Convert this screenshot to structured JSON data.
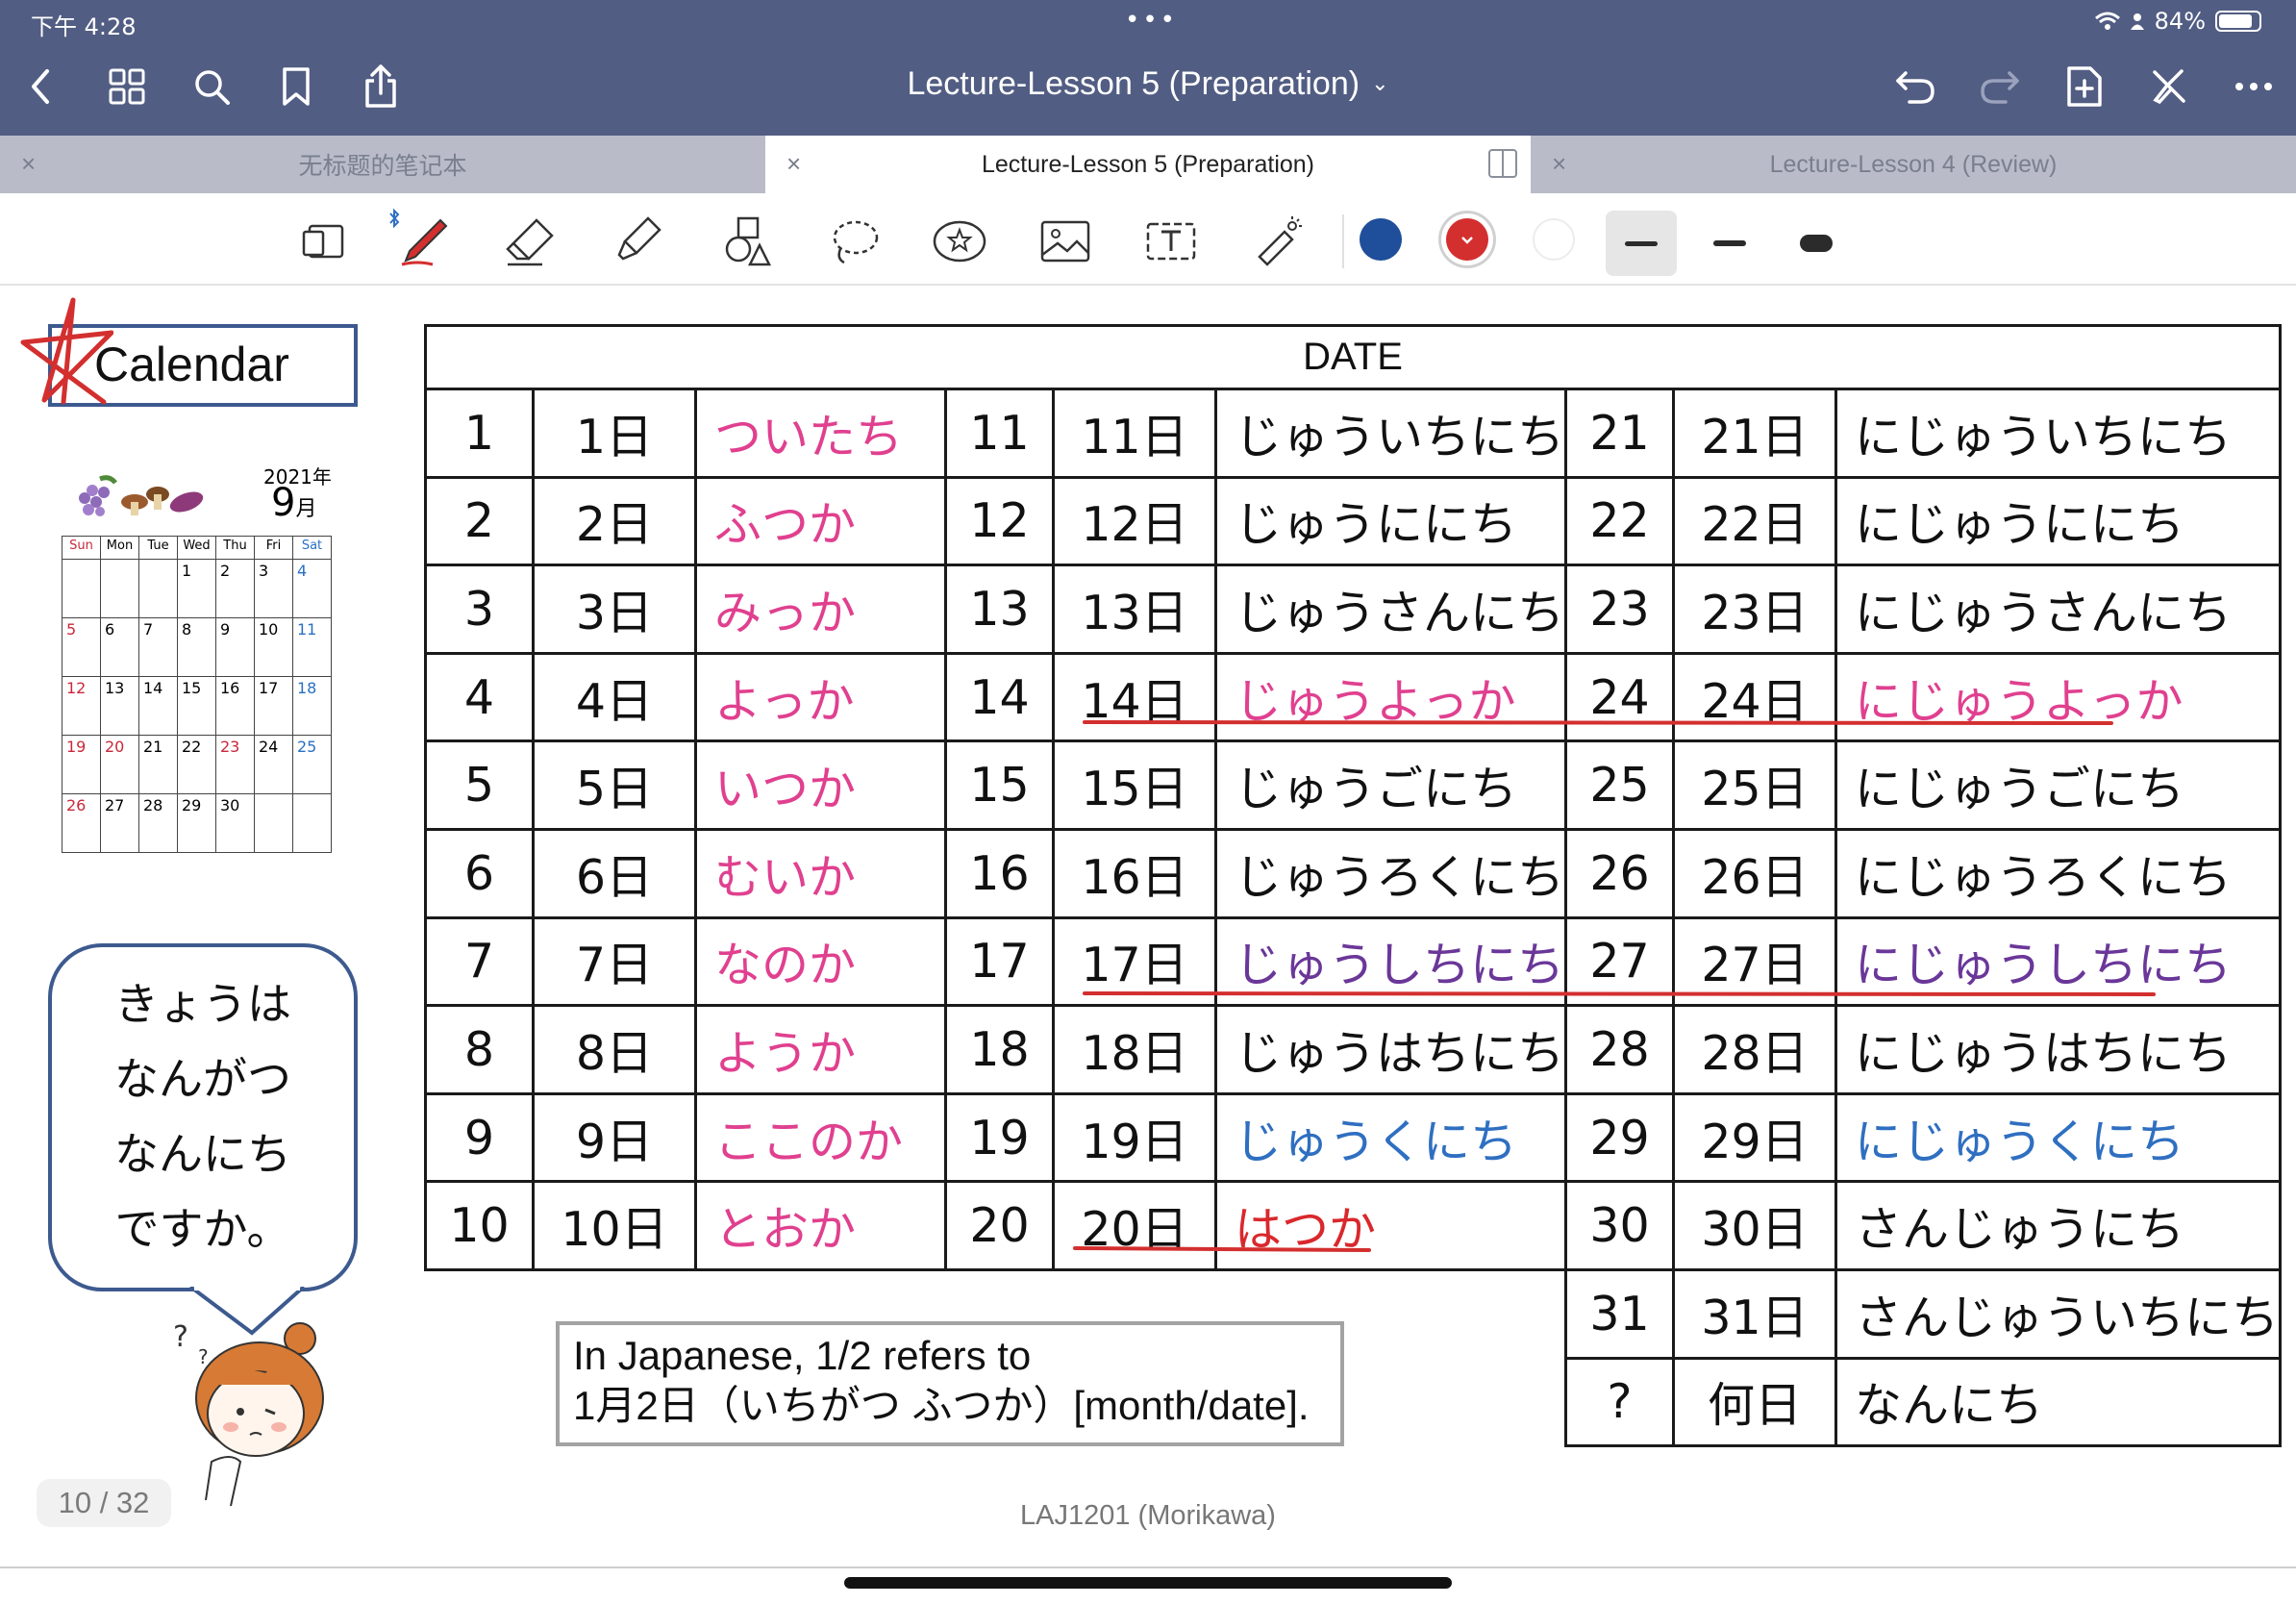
{
  "status": {
    "time": "下午 4:28",
    "dots": "•••",
    "battery": "84%",
    "battery_level": 0.84
  },
  "nav": {
    "title": "Lecture-Lesson 5 (Preparation)"
  },
  "tabs": [
    {
      "label": "无标题的笔记本",
      "active": false
    },
    {
      "label": "Lecture-Lesson 5 (Preparation)",
      "active": true
    },
    {
      "label": "Lecture-Lesson 4 (Review)",
      "active": false
    }
  ],
  "toolbar": {
    "tools": [
      "page-view",
      "pen",
      "eraser",
      "highlighter",
      "shapes",
      "lasso",
      "sticker",
      "image",
      "text",
      "laser-pointer"
    ],
    "colors": [
      "#1f4e9a",
      "#d32f2f",
      "#ffffff"
    ],
    "selected_color": "#d32f2f",
    "active_tool": "pen"
  },
  "calendar_title": "Calendar",
  "mini_calendar": {
    "year": "2021年",
    "month": "9",
    "month_suffix": "月",
    "weekdays": [
      "Sun",
      "Mon",
      "Tue",
      "Wed",
      "Thu",
      "Fri",
      "Sat"
    ],
    "weeks": [
      [
        "",
        "",
        "",
        "1",
        "2",
        "3",
        "4"
      ],
      [
        "5",
        "6",
        "7",
        "8",
        "9",
        "10",
        "11"
      ],
      [
        "12",
        "13",
        "14",
        "15",
        "16",
        "17",
        "18"
      ],
      [
        "19",
        "20",
        "21",
        "22",
        "23",
        "24",
        "25"
      ],
      [
        "26",
        "27",
        "28",
        "29",
        "30",
        "",
        ""
      ]
    ]
  },
  "speech_bubble": [
    "きょうは",
    "なんがつ",
    "なんにち",
    "ですか。"
  ],
  "date_table": {
    "header": "DATE",
    "rows": [
      [
        [
          "1",
          "1日",
          "ついたち"
        ],
        [
          "11",
          "11日",
          "じゅういちにち"
        ],
        [
          "21",
          "21日",
          "にじゅういちにち"
        ]
      ],
      [
        [
          "2",
          "2日",
          "ふつか"
        ],
        [
          "12",
          "12日",
          "じゅうににち"
        ],
        [
          "22",
          "22日",
          "にじゅうににち"
        ]
      ],
      [
        [
          "3",
          "3日",
          "みっか"
        ],
        [
          "13",
          "13日",
          "じゅうさんにち"
        ],
        [
          "23",
          "23日",
          "にじゅうさんにち"
        ]
      ],
      [
        [
          "4",
          "4日",
          "よっか"
        ],
        [
          "14",
          "14日",
          "じゅうよっか"
        ],
        [
          "24",
          "24日",
          "にじゅうよっか"
        ]
      ],
      [
        [
          "5",
          "5日",
          "いつか"
        ],
        [
          "15",
          "15日",
          "じゅうごにち"
        ],
        [
          "25",
          "25日",
          "にじゅうごにち"
        ]
      ],
      [
        [
          "6",
          "6日",
          "むいか"
        ],
        [
          "16",
          "16日",
          "じゅうろくにち"
        ],
        [
          "26",
          "26日",
          "にじゅうろくにち"
        ]
      ],
      [
        [
          "7",
          "7日",
          "なのか"
        ],
        [
          "17",
          "17日",
          "じゅうしちにち"
        ],
        [
          "27",
          "27日",
          "にじゅうしちにち"
        ]
      ],
      [
        [
          "8",
          "8日",
          "ようか"
        ],
        [
          "18",
          "18日",
          "じゅうはちにち"
        ],
        [
          "28",
          "28日",
          "にじゅうはちにち"
        ]
      ],
      [
        [
          "9",
          "9日",
          "ここのか"
        ],
        [
          "19",
          "19日",
          "じゅうくにち"
        ],
        [
          "29",
          "29日",
          "にじゅうくにち"
        ]
      ],
      [
        [
          "10",
          "10日",
          "とおか"
        ],
        [
          "20",
          "20日",
          "はつか"
        ],
        [
          "30",
          "30日",
          "さんじゅうにち"
        ]
      ]
    ],
    "extra_rows": [
      [
        "31",
        "31日",
        "さんじゅういちにち"
      ],
      [
        "?",
        "何日",
        "なんにち"
      ]
    ]
  },
  "note": {
    "line1": "In Japanese, 1/2 refers to",
    "line2": "1月2日（いちがつ ふつか）[month/date]."
  },
  "footer": "LAJ1201 (Morikawa)",
  "page_indicator": "10 / 32",
  "colors": {
    "nav": "#525d83",
    "pink": "#e0408f",
    "purple": "#6a3799",
    "blue": "#2f6fc1",
    "red": "#d9282c",
    "frame": "#3d5a8f"
  }
}
